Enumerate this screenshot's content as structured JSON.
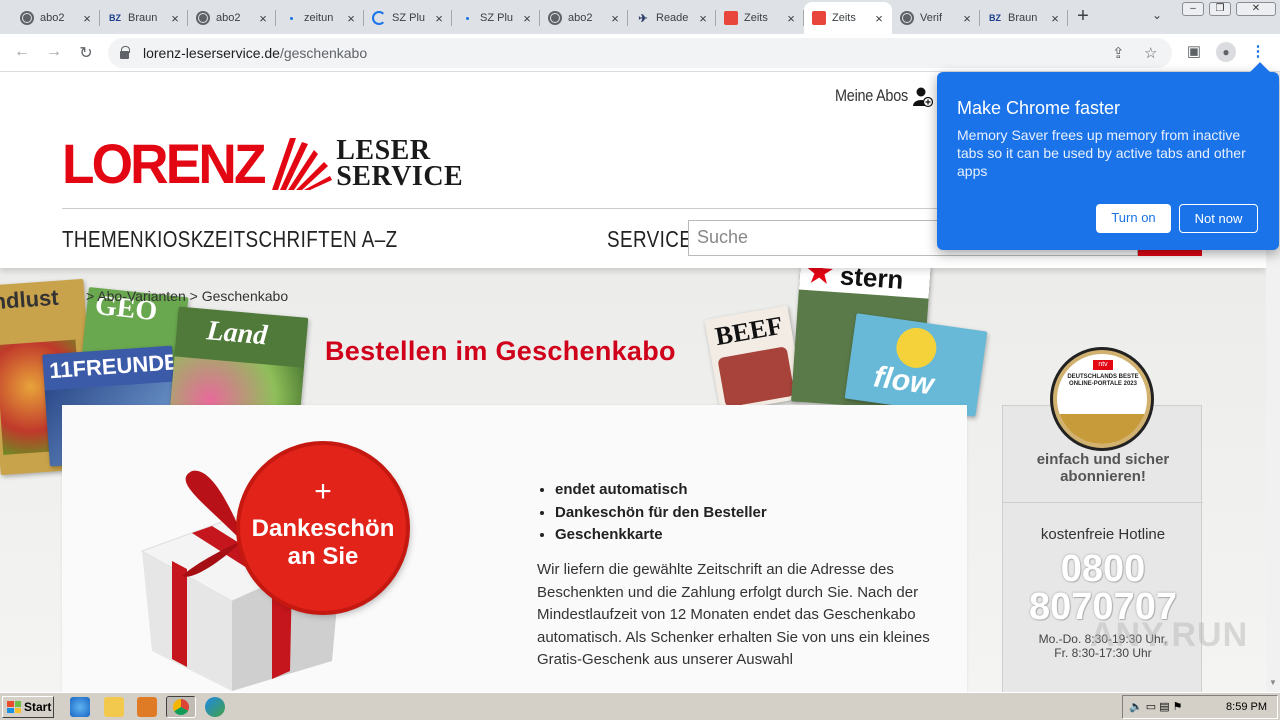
{
  "browser": {
    "tabs": [
      {
        "label": "abo2",
        "favicon": "globe-icon",
        "active": false
      },
      {
        "label": "Braun",
        "favicon": "bz-icon",
        "active": false
      },
      {
        "label": "abo2",
        "favicon": "globe-icon",
        "active": false
      },
      {
        "label": "zeitun",
        "favicon": "loading-dot-icon",
        "active": false
      },
      {
        "label": "SZ Plu",
        "favicon": "loading-spinner-icon",
        "active": false
      },
      {
        "label": "SZ Plu",
        "favicon": "loading-dot-icon",
        "active": false
      },
      {
        "label": "abo2",
        "favicon": "globe-icon",
        "active": false
      },
      {
        "label": "Reade",
        "favicon": "bird-icon",
        "active": false
      },
      {
        "label": "Zeits",
        "favicon": "lorenz-icon",
        "active": false
      },
      {
        "label": "Zeits",
        "favicon": "lorenz-icon",
        "active": true
      },
      {
        "label": "Verif",
        "favicon": "globe-icon",
        "active": false
      },
      {
        "label": "Braun",
        "favicon": "bz-icon",
        "active": false
      }
    ],
    "url_domain": "lorenz-leserservice.de",
    "url_path": "/geschenkabo",
    "bz_text": "BZ",
    "close_glyph": "×",
    "new_tab_glyph": "+"
  },
  "site": {
    "meine_abos": "Meine Abos",
    "logo_word": "LORENZ",
    "logo_line1": "LESER",
    "logo_line2": "SERVICE",
    "nav": {
      "themenkiosk": "THEMENKIOSK",
      "zeitschriften": "ZEITSCHRIFTEN A–Z",
      "service": "SERVICE"
    },
    "search_placeholder": "Suche",
    "breadcrumb": "> Abo-Varianten > Geschenkabo",
    "title": "Bestellen im Geschenkabo",
    "magazines": [
      "ndlust",
      "GEO",
      "11FREUNDE",
      "Land",
      "BEEF",
      "stern",
      "flow"
    ],
    "gift_badge_plus": "+",
    "gift_badge_line1": "Dankeschön",
    "gift_badge_line2": "an Sie",
    "features": [
      "endet automatisch",
      "Dankeschön für den Besteller",
      "Geschenkkarte"
    ],
    "description": "Wir liefern die gewählte Zeitschrift an die Adresse des Beschenkten und die Zahlung erfolgt durch Sie. Nach der Mindestlaufzeit von 12 Monaten endet das Geschenkabo automatisch. Als Schenker erhalten Sie von uns ein kleines Gratis-Geschenk aus unserer Auswahl",
    "sidebar": {
      "seal_brand": "ntv",
      "seal_text": "DEUTSCHLANDS BESTE ONLINE-PORTALE 2023",
      "slogan": "einfach und sicher abonnieren!",
      "hotline_label": "kostenfreie Hotline",
      "hotline_line1": "0800",
      "hotline_line2": "8070707",
      "hours_line1": "Mo.-Do. 8:30-19:30 Uhr,",
      "hours_line2": "Fr. 8:30-17:30 Uhr"
    }
  },
  "popup": {
    "title": "Make Chrome faster",
    "body": "Memory Saver frees up memory from inactive tabs so it can be used by active tabs and other apps",
    "primary_button": "Turn on",
    "secondary_button": "Not now"
  },
  "taskbar": {
    "start": "Start",
    "clock": "8:59 PM"
  },
  "watermark": "ANY.RUN",
  "colors": {
    "brand_red": "#e30613",
    "title_red": "#d0021b",
    "chrome_blue": "#1a73e8"
  }
}
